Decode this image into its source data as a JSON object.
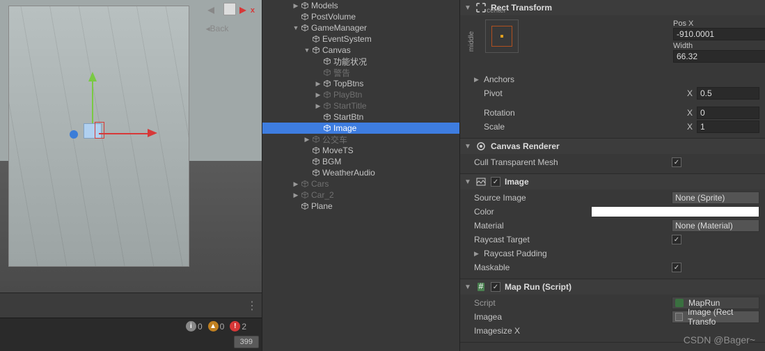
{
  "scene": {
    "back_label": "Back",
    "gizmo_x": "x",
    "status_info": "0",
    "status_warn": "0",
    "status_error": "2",
    "badge_399": "399"
  },
  "hierarchy": [
    {
      "indent": 42,
      "foldout": "▶",
      "label": "Models",
      "dim": false
    },
    {
      "indent": 42,
      "foldout": "",
      "label": "PostVolume",
      "dim": false
    },
    {
      "indent": 42,
      "foldout": "▼",
      "label": "GameManager",
      "dim": false
    },
    {
      "indent": 58,
      "foldout": "",
      "label": "EventSystem",
      "dim": false
    },
    {
      "indent": 58,
      "foldout": "▼",
      "label": "Canvas",
      "dim": false
    },
    {
      "indent": 74,
      "foldout": "",
      "label": "功能状况",
      "dim": false
    },
    {
      "indent": 74,
      "foldout": "",
      "label": "警告",
      "dim": true
    },
    {
      "indent": 74,
      "foldout": "▶",
      "label": "TopBtns",
      "dim": false
    },
    {
      "indent": 74,
      "foldout": "▶",
      "label": "PlayBtn",
      "dim": true
    },
    {
      "indent": 74,
      "foldout": "▶",
      "label": "StartTitle",
      "dim": true
    },
    {
      "indent": 74,
      "foldout": "",
      "label": "StartBtn",
      "dim": false
    },
    {
      "indent": 74,
      "foldout": "",
      "label": "Image",
      "dim": false,
      "selected": true
    },
    {
      "indent": 58,
      "foldout": "▶",
      "label": "公交车",
      "dim": true
    },
    {
      "indent": 58,
      "foldout": "",
      "label": "MoveTS",
      "dim": false
    },
    {
      "indent": 58,
      "foldout": "",
      "label": "BGM",
      "dim": false
    },
    {
      "indent": 58,
      "foldout": "",
      "label": "WeatherAudio",
      "dim": false
    },
    {
      "indent": 42,
      "foldout": "▶",
      "label": "Cars",
      "dim": true
    },
    {
      "indent": 42,
      "foldout": "▶",
      "label": "Car_2",
      "dim": true
    },
    {
      "indent": 42,
      "foldout": "",
      "label": "Plane",
      "dim": false
    }
  ],
  "inspector": {
    "rect_transform": {
      "title": "Rect Transform",
      "center_label": "center",
      "middle_label": "middle",
      "posx_label": "Pos X",
      "posx_value": "-910.0001",
      "width_label": "Width",
      "width_value": "66.32",
      "anchors_label": "Anchors",
      "pivot_label": "Pivot",
      "pivot_x": "0.5",
      "rotation_label": "Rotation",
      "rotation_x": "0",
      "scale_label": "Scale",
      "scale_x": "1",
      "x_label": "X"
    },
    "canvas_renderer": {
      "title": "Canvas Renderer",
      "cull_label": "Cull Transparent Mesh",
      "cull_checked": true
    },
    "image": {
      "title": "Image",
      "source_label": "Source Image",
      "source_value": "None (Sprite)",
      "color_label": "Color",
      "material_label": "Material",
      "material_value": "None (Material)",
      "raycast_target_label": "Raycast Target",
      "raycast_target_checked": true,
      "raycast_padding_label": "Raycast Padding",
      "maskable_label": "Maskable",
      "maskable_checked": true
    },
    "maprun": {
      "title": "Map Run (Script)",
      "script_label": "Script",
      "script_value": "MapRun",
      "imagea_label": "Imagea",
      "imagea_value": "Image (Rect Transfo",
      "imagesize_label": "Imagesize X"
    }
  },
  "watermark": "CSDN @Bager~"
}
